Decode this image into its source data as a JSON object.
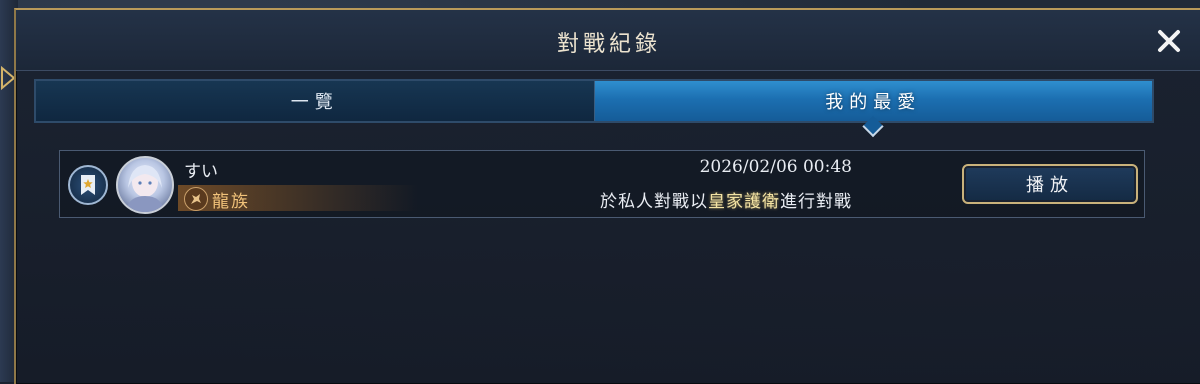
{
  "dialog": {
    "title": "對戰紀錄"
  },
  "tabs": [
    {
      "label": "一覽",
      "selected": false
    },
    {
      "label": "我的最愛",
      "selected": true
    }
  ],
  "records": [
    {
      "username": "すい",
      "class_name": "龍族",
      "datetime": "2026/02/06 00:48",
      "description_prefix": "於私人對戰以",
      "description_highlight": "皇家護衛",
      "description_suffix": "進行對戰",
      "play_label": "播放"
    }
  ],
  "colors": {
    "accent_gold": "#b99a5a",
    "tab_selected": "#1c6fb1",
    "class_text": "#f1c27a"
  },
  "icons": {
    "close": "close-icon",
    "favorite": "star-bookmark-icon",
    "class": "dragon-icon"
  }
}
